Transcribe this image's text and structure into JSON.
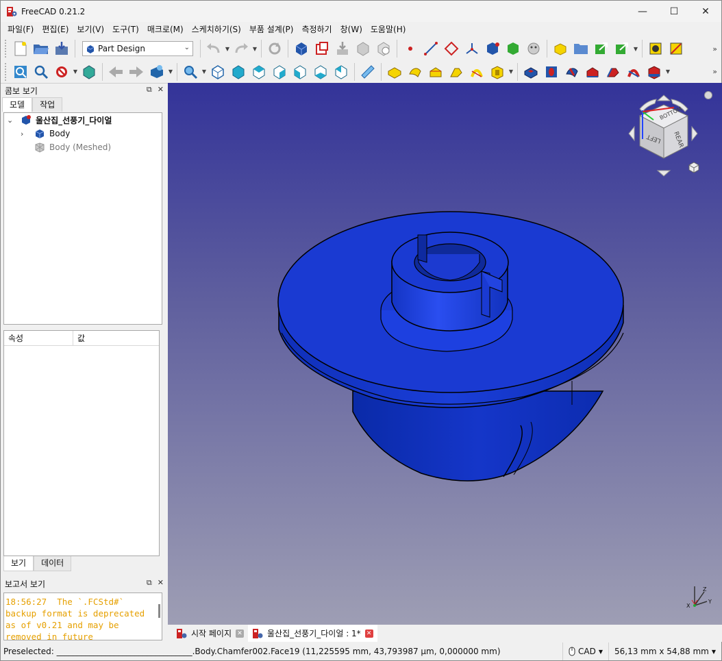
{
  "window": {
    "title": "FreeCAD 0.21.2",
    "minimize": "—",
    "maximize": "☐",
    "close": "✕"
  },
  "menu": [
    "파일(F)",
    "편집(E)",
    "보기(V)",
    "도구(T)",
    "매크로(M)",
    "스케치하기(S)",
    "부품 설계(P)",
    "측정하기",
    "창(W)",
    "도움말(H)"
  ],
  "toolbar": {
    "workbench": "Part Design",
    "overflow": "»"
  },
  "combo_view": {
    "title": "콤보 보기",
    "tabs": [
      "모델",
      "작업"
    ],
    "tree": {
      "root": "울산집_선풍기_다이얼",
      "items": [
        "Body",
        "Body (Meshed)"
      ]
    },
    "properties": {
      "col_property": "속성",
      "col_value": "값"
    },
    "bottom_tabs": [
      "보기",
      "데이터"
    ]
  },
  "report_view": {
    "title": "보고서 보기",
    "text": "18:56:27  The `.FCStd#` backup format is deprecated as of v0.21 and may be removed in future"
  },
  "navcube": {
    "faces": [
      "BOTTOM",
      "LEFT",
      "REAR"
    ]
  },
  "axes": {
    "x": "X",
    "y": "Y",
    "z": "Z"
  },
  "doc_tabs": [
    "시작 페이지",
    "울산집_선풍기_다이얼 : 1*"
  ],
  "status": {
    "preselected": "Preselected: _________________________________.Body.Chamfer002.Face19 (11,225595 mm, 43,793987 µm, 0,000000 mm)",
    "nav_style": "CAD",
    "dimensions": "56,13 mm x 54,88 mm"
  },
  "colors": {
    "model_blue": "#1133cc",
    "accent_red": "#cc2222",
    "report_text": "#e6a000"
  }
}
